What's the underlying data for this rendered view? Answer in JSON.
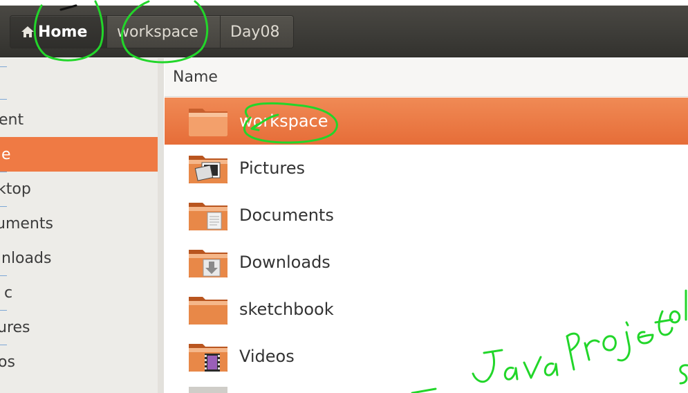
{
  "breadcrumbs": [
    {
      "label": "Home",
      "active": true
    },
    {
      "label": "workspace",
      "active": false
    },
    {
      "label": "Day08",
      "active": false
    }
  ],
  "sidebar": {
    "items": [
      {
        "label": "ent",
        "selected": false
      },
      {
        "label": "e",
        "selected": true
      },
      {
        "label": "ktop",
        "selected": false
      },
      {
        "label": "uments",
        "selected": false
      },
      {
        "label": "nloads",
        "selected": false
      },
      {
        "label": "c",
        "selected": false
      },
      {
        "label": "ures",
        "selected": false
      },
      {
        "label": "os",
        "selected": false
      }
    ]
  },
  "list": {
    "column_name": "Name",
    "rows": [
      {
        "name": "workspace",
        "icon": "folder-icon",
        "selected": true
      },
      {
        "name": "Pictures",
        "icon": "folder-pictures-icon",
        "selected": false
      },
      {
        "name": "Documents",
        "icon": "folder-documents-icon",
        "selected": false
      },
      {
        "name": "Downloads",
        "icon": "folder-downloads-icon",
        "selected": false
      },
      {
        "name": "sketchbook",
        "icon": "folder-icon",
        "selected": false
      },
      {
        "name": "Videos",
        "icon": "folder-videos-icon",
        "selected": false
      }
    ]
  },
  "colors": {
    "accent": "#ef7a44",
    "toolbar": "#3c3b37",
    "annotation": "#22d62a"
  }
}
